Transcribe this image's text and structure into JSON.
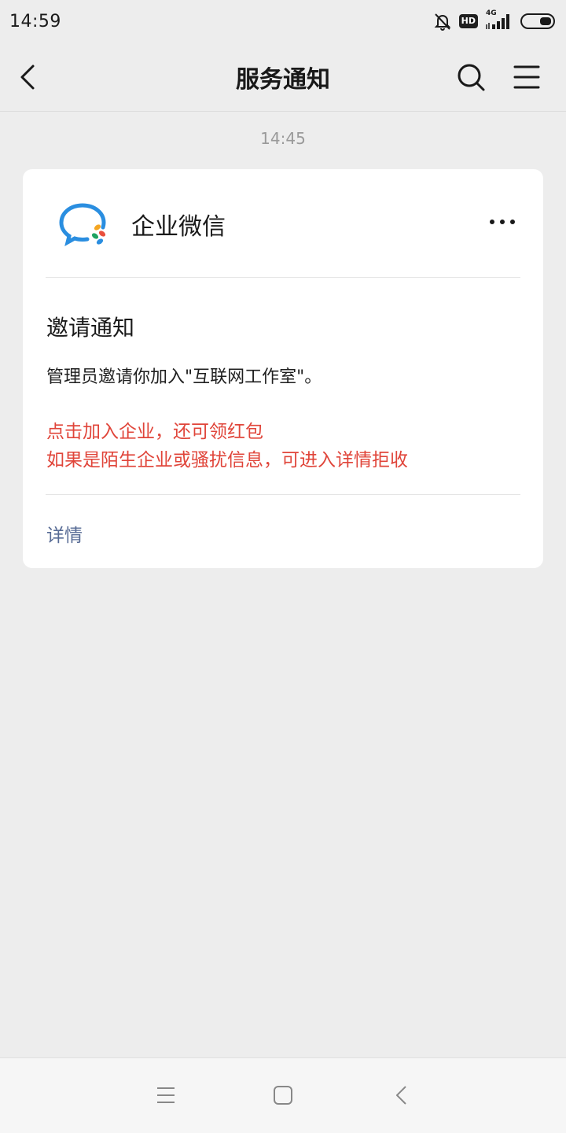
{
  "status_bar": {
    "time": "14:59",
    "hd_label": "HD",
    "network_label": "4G",
    "icons": [
      "mute-bell-icon",
      "hd-icon",
      "signal-icon",
      "battery-icon"
    ]
  },
  "nav": {
    "title": "服务通知",
    "icons": [
      "back-chevron-icon",
      "search-icon",
      "menu-icon"
    ]
  },
  "message": {
    "time": "14:45",
    "card": {
      "app_name": "企业微信",
      "title": "邀请通知",
      "description": "管理员邀请你加入\"互联网工作室\"。",
      "promo_line1": "点击加入企业，还可领红包",
      "promo_line2": "如果是陌生企业或骚扰信息，可进入详情拒收",
      "detail_label": "详情"
    }
  },
  "system_nav": {
    "icons": [
      "recent-apps-icon",
      "home-icon",
      "back-icon"
    ]
  },
  "colors": {
    "background": "#ededed",
    "card": "#ffffff",
    "promo_red": "#e0453a",
    "link_blue": "#576b95",
    "logo_blue": "#2a8ee0"
  }
}
